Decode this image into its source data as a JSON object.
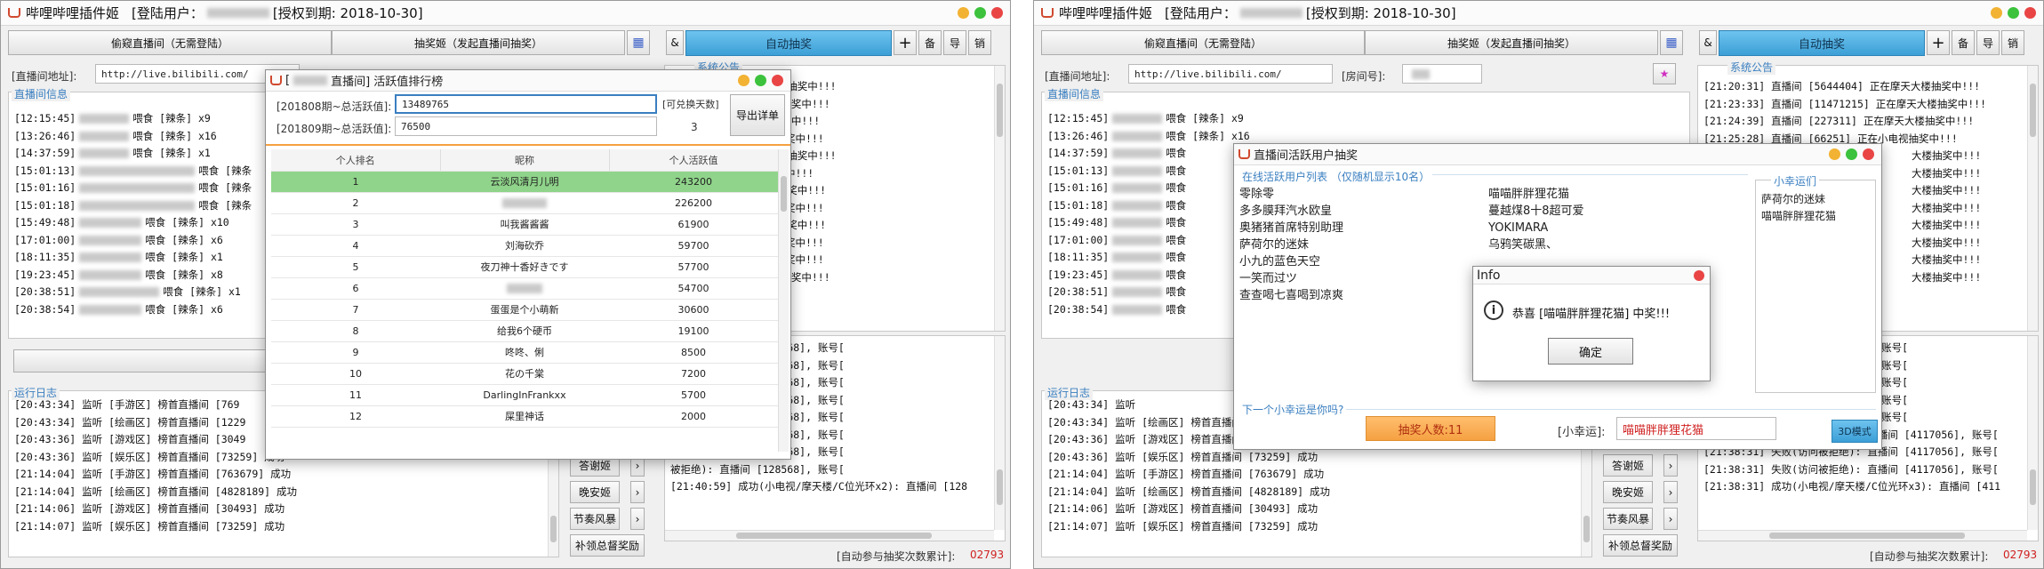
{
  "app": {
    "title": "哔哩哔哩插件姬",
    "login_label": "[登陆用户：",
    "auth_label": "[授权到期: 2018-10-30]"
  },
  "colors": {
    "accent_blue": "#3c9fd6",
    "selected_row": "#8fd48a",
    "lottery_orange": "#f5a142",
    "title_blue": "#3a7fc0"
  },
  "toolbar": {
    "tab_guard": "偷窥直播间（无需登陆）",
    "tab_lottery": "抽奖姬（发起直播间抽奖）",
    "auto_lottery": "自动抽奖",
    "grid_icon": "grid-icon",
    "btn_plus": "+",
    "btn_bei": "备",
    "btn_dao": "导",
    "btn_xiao": "销",
    "btn_s": "&"
  },
  "room": {
    "url_label": "[直播间地址]:",
    "url_value": "http://live.bilibili.com/",
    "room_no_label": "[房间号]:",
    "info_title": "直播间信息",
    "log_title": "运行日志",
    "notice_title": "系统公告"
  },
  "left": {
    "gift_log": [
      {
        "t": "[12:15:45]",
        "msg": "喂食 [辣条] x9"
      },
      {
        "t": "[13:26:46]",
        "msg": "喂食 [辣条] x16"
      },
      {
        "t": "[14:37:59]",
        "msg": "喂食 [辣条] x1"
      },
      {
        "t": "[15:01:13]",
        "msg": "喂食 [辣条"
      },
      {
        "t": "[15:01:16]",
        "msg": "喂食 [辣条"
      },
      {
        "t": "[15:01:18]",
        "msg": "喂食 [辣条"
      },
      {
        "t": "[15:49:48]",
        "msg": "喂食 [辣条] x10"
      },
      {
        "t": "[17:01:00]",
        "msg": "喂食 [辣条] x6"
      },
      {
        "t": "[18:11:35]",
        "msg": "喂食 [辣条] x1"
      },
      {
        "t": "[19:23:45]",
        "msg": "喂食 [辣条] x8"
      },
      {
        "t": "[20:38:51]",
        "msg": "喂食 [辣条] x1"
      },
      {
        "t": "[20:38:54]",
        "msg": "喂食 [辣条] x6"
      }
    ],
    "notice_lines": [
      "2734726] 正在摩天大楼抽奖中!!!",
      "697733] 正在摩天大楼抽奖中!!!",
      "697733] 正在小电视抽奖中!!!",
      "35352] 正在摩天大楼抽奖中!!!",
      "6817488] 正在摩天大楼抽奖中!!!",
      "47377] 正在小电视抽奖中!!!",
      "4117056] 正在小电视抽奖中!!!",
      "30493] 正在摩天大楼抽奖中!!!",
      "4117056] 正在小电视抽奖中!!!",
      "35298] 正在摩天大楼抽奖中!!!",
      "48230] 正在摩天大楼抽奖中!!!",
      "868405] 正在摩天大楼抽奖中!!!"
    ],
    "run_log": [
      "[20:43:34] 监听 [手游区] 榜首直播间 [769",
      "[20:43:34] 监听 [绘画区] 榜首直播间 [1229",
      "[20:43:36] 监听 [游戏区] 榜首直播间 [3049",
      "[20:43:36] 监听 [娱乐区] 榜首直播间 [73259] 成功",
      "[21:14:04] 监听 [手游区] 榜首直播间 [763679] 成功",
      "[21:14:04] 监听 [绘画区] 榜首直播间 [4828189] 成功",
      "[21:14:06] 监听 [游戏区] 榜首直播间 [30493] 成功",
      "[21:14:07] 监听 [娱乐区] 榜首直播间 [73259] 成功"
    ],
    "right_log": [
      "被拒绝): 直播间 [128568], 账号[",
      "被拒绝): 直播间 [128568], 账号[",
      "被拒绝): 直播间 [128568], 账号[",
      "被拒绝): 直播间 [128568], 账号[",
      "被拒绝): 直播间 [128568], 账号[",
      "被拒绝): 直播间 [128568], 账号[",
      "被拒绝): 直播间 [128568], 账号[",
      "被拒绝): 直播间 [128568], 账号[",
      "[21:40:59] 成功(小电视/摩天楼/C位光环x2): 直播间 [128"
    ],
    "side_buttons": [
      "答谢姬",
      "晚安姬",
      "节奏风暴",
      "补领总督奖励"
    ],
    "counter_label": "[自动参与抽奖次数累计]:",
    "counter_value": "02793"
  },
  "rank_dialog": {
    "title_prefix": "[",
    "title": "直播间] 活跃值排行榜",
    "row1_label": "[201808期~总活跃值]:",
    "row1_value": "13489765",
    "row2_label": "[201809期~总活跃值]:",
    "row2_value": "76500",
    "exchange_label": "[可兑换天数]",
    "exchange_value": "3",
    "export_button": "导出详单",
    "headers": [
      "个人排名",
      "昵称",
      "个人活跃值"
    ],
    "rows": [
      {
        "rank": "1",
        "name": "云淡风清月儿明",
        "score": "243200"
      },
      {
        "rank": "2",
        "name": "",
        "score": "226200"
      },
      {
        "rank": "3",
        "name": "叫我酱酱酱",
        "score": "61900"
      },
      {
        "rank": "4",
        "name": "刘海砍乔",
        "score": "59700"
      },
      {
        "rank": "5",
        "name": "夜刀神十香好きです",
        "score": "57700"
      },
      {
        "rank": "6",
        "name": "",
        "score": "54700"
      },
      {
        "rank": "7",
        "name": "蛋蛋是个小萌新",
        "score": "30600"
      },
      {
        "rank": "8",
        "name": "给我6个硬币",
        "score": "19100"
      },
      {
        "rank": "9",
        "name": "咚咚、俐",
        "score": "8500"
      },
      {
        "rank": "10",
        "name": "花の千棠",
        "score": "7200"
      },
      {
        "rank": "11",
        "name": "DarlingInFrankxx",
        "score": "5700"
      },
      {
        "rank": "12",
        "name": "屎里神话",
        "score": "2000"
      }
    ]
  },
  "right": {
    "gift_log": [
      {
        "t": "[12:15:45]",
        "msg": "喂食 [辣条] x9"
      },
      {
        "t": "[13:26:46]",
        "msg": "喂食 [辣条] x16"
      },
      {
        "t": "[14:37:59]",
        "msg": "喂食"
      },
      {
        "t": "[15:01:13]",
        "msg": "喂食"
      },
      {
        "t": "[15:01:16]",
        "msg": "喂食"
      },
      {
        "t": "[15:01:18]",
        "msg": "喂食"
      },
      {
        "t": "[15:49:48]",
        "msg": "喂食"
      },
      {
        "t": "[17:01:00]",
        "msg": "喂食"
      },
      {
        "t": "[18:11:35]",
        "msg": "喂食"
      },
      {
        "t": "[19:23:45]",
        "msg": "喂食"
      },
      {
        "t": "[20:38:51]",
        "msg": "喂食"
      },
      {
        "t": "[20:38:54]",
        "msg": "喂食"
      }
    ],
    "notice_lines": [
      "[21:20:31] 直播间 [5644404] 正在摩天大楼抽奖中!!!",
      "[21:23:33] 直播间 [11471215] 正在摩天大楼抽奖中!!!",
      "[21:24:39] 直播间 [227311] 正在摩天大楼抽奖中!!!",
      "[21:25:28] 直播间 [66251] 正在小电视抽奖中!!!",
      "大楼抽奖中!!!",
      "大楼抽奖中!!!",
      "大楼抽奖中!!!",
      "大楼抽奖中!!!",
      "大楼抽奖中!!!",
      "大楼抽奖中!!!",
      "大楼抽奖中!!!",
      "大楼抽奖中!!!"
    ],
    "run_log": [
      "[20:43:34] 监听",
      "[20:43:34] 监听 [绘画区] 榜首直播间",
      "[20:43:36] 监听 [游戏区] 榜首直播间",
      "[20:43:36] 监听 [娱乐区] 榜首直播间 [73259] 成功",
      "[21:14:04] 监听 [手游区] 榜首直播间 [763679] 成功",
      "[21:14:04] 监听 [绘画区] 榜首直播间 [4828189] 成功",
      "[21:14:06] 监听 [游戏区] 榜首直播间 [30493] 成功",
      "[21:14:07] 监听 [娱乐区] 榜首直播间 [73259] 成功"
    ],
    "right_log": [
      "[4117056], 账号[",
      "[4117056], 账号[",
      "[4117056], 账号[",
      "[4117056], 账号[",
      "[4117056], 账号[",
      "[21:38:31] 失败(访问被拒绝): 直播间 [4117056], 账号[",
      "[21:38:31] 失败(访问被拒绝): 直播间 [4117056], 账号[",
      "[21:38:31] 失败(访问被拒绝): 直播间 [4117056], 账号[",
      "[21:38:31] 成功(小电视/摩天楼/C位光环x3): 直播间 [411"
    ],
    "side_buttons": [
      "答谢姬",
      "晚安姬",
      "节奏风暴",
      "补领总督奖励"
    ],
    "counter_label": "[自动参与抽奖次数累计]:",
    "counter_value": "02793"
  },
  "lottery_dialog": {
    "title": "直播间活跃用户抽奖",
    "online_title": "在线活跃用户列表 （仅随机显示10名）",
    "users_col1": [
      "零除零",
      "多多膜拜汽水欧皇",
      "奥猪猪首席特别助理",
      "萨荷尔的迷妹",
      "小九的蓝色天空",
      "一笑而过ツ",
      "查查喝七喜喝到凉爽"
    ],
    "users_col2": [
      "喵喵胖胖狸花猫",
      "蔓越煤8十8超可爱",
      "YOKIMARA",
      "乌鸦笑碳黑、"
    ],
    "lucky_title": "小幸运们",
    "lucky_list": [
      "萨荷尔的迷妹",
      "喵喵胖胖狸花猫"
    ],
    "next_title": "下一个小幸运是你吗?",
    "draw_button": "抽奖人数:11",
    "lucky_label": "[小幸运]:",
    "lucky_value": "喵喵胖胖狸花猫",
    "mode_button": "3D模式"
  },
  "info_dialog": {
    "title": "Info",
    "message": "恭喜 [喵喵胖胖狸花猫] 中奖!!!",
    "ok_button": "确定"
  }
}
